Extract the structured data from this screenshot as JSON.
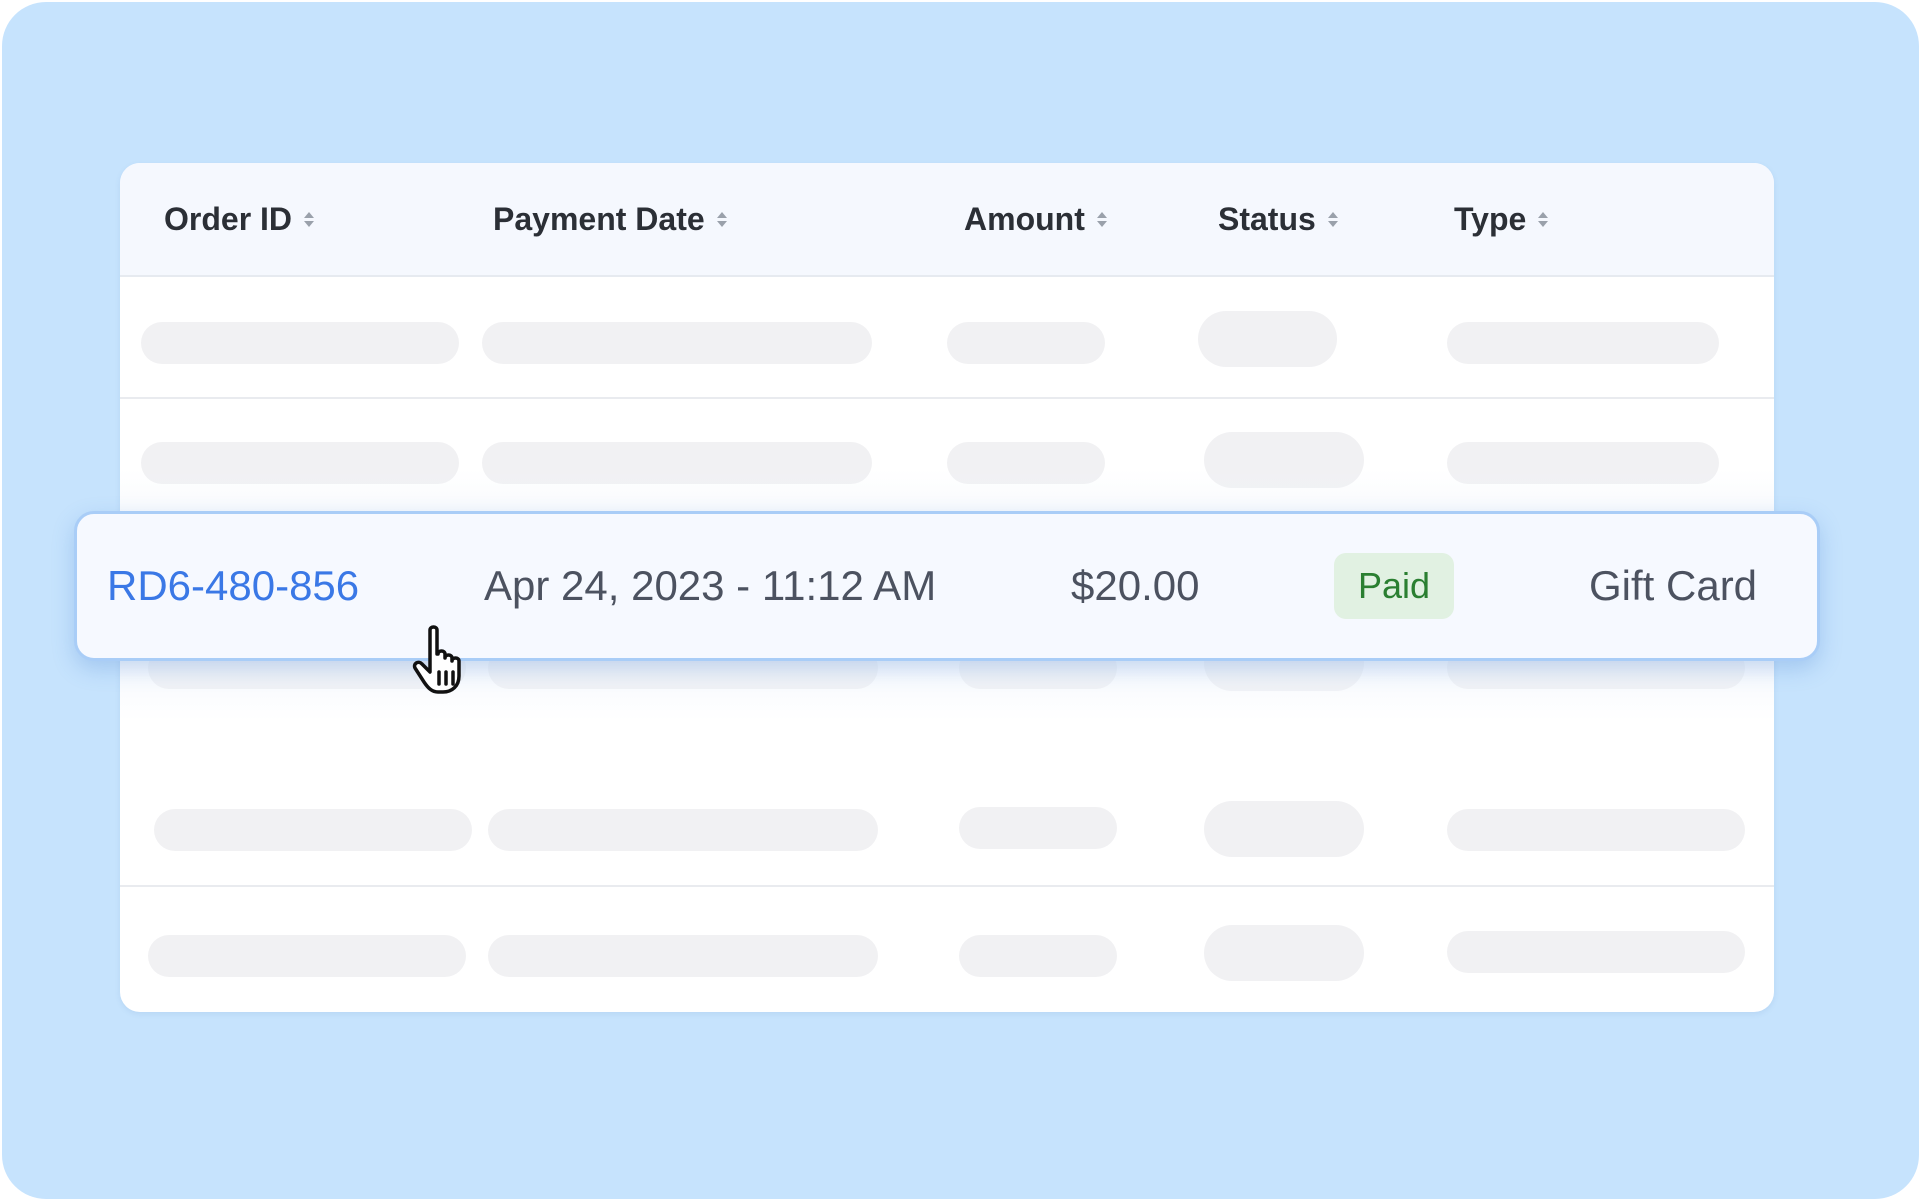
{
  "table": {
    "columns": [
      {
        "label": "Order ID",
        "sort_icon": "sort-up-down-icon"
      },
      {
        "label": "Payment Date",
        "sort_icon": "sort-up-down-icon"
      },
      {
        "label": "Amount",
        "sort_icon": "sort-up-down-icon"
      },
      {
        "label": "Status",
        "sort_icon": "sort-up-down-icon"
      },
      {
        "label": "Type",
        "sort_icon": "sort-up-down-icon"
      }
    ],
    "highlighted_row": {
      "order_id": "RD6-480-856",
      "payment_date": "Apr 24, 2023 - 11:12 AM",
      "amount": "$20.00",
      "status": "Paid",
      "type": "Gift Card"
    },
    "placeholder_rows": 5
  },
  "cursor": {
    "icon": "hand-pointer-icon"
  },
  "colors": {
    "background": "#c6e3fd",
    "link": "#3a78e6",
    "status_paid_bg": "#e1f1e2",
    "status_paid_text": "#2a7f31",
    "hover_border": "#a9cdf7"
  }
}
